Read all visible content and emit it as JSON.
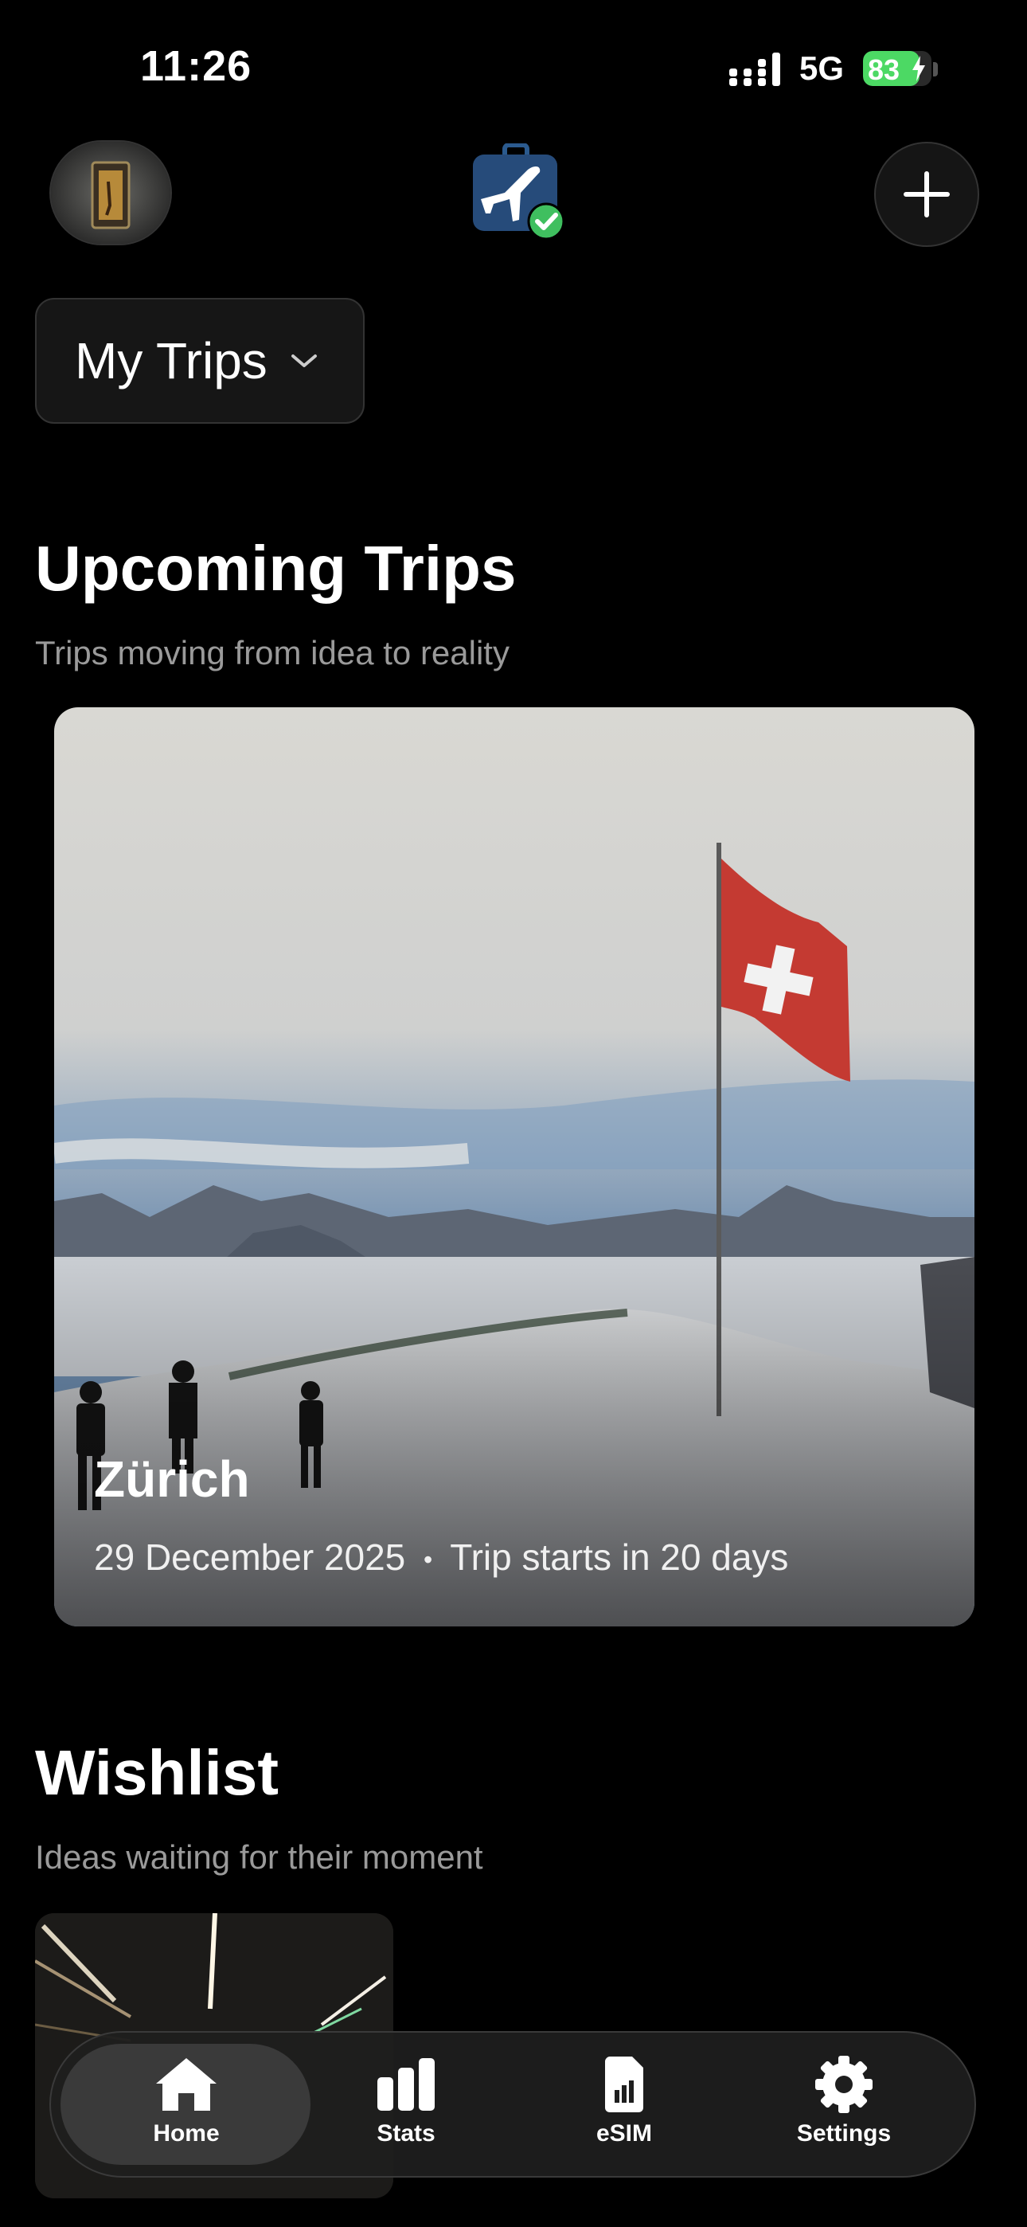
{
  "status_bar": {
    "time": "11:26",
    "network": "5G",
    "battery": "83",
    "battery_level": 0.83,
    "battery_color": "#4cd964"
  },
  "header": {
    "avatar_icon": "door-photo-avatar",
    "logo_icon": "suitcase-plane-check-icon",
    "add_icon": "plus-icon"
  },
  "trips_selector": {
    "label": "My Trips"
  },
  "upcoming": {
    "title": "Upcoming Trips",
    "subtitle": "Trips moving from idea to reality",
    "trip": {
      "city": "Zürich",
      "date": "29 December 2025",
      "separator": "•",
      "countdown": "Trip starts in 20 days"
    }
  },
  "wishlist": {
    "title": "Wishlist",
    "subtitle": "Ideas waiting for their moment"
  },
  "tabs": [
    {
      "label": "Home",
      "icon": "home-icon",
      "active": true
    },
    {
      "label": "Stats",
      "icon": "bar-chart-icon",
      "active": false
    },
    {
      "label": "eSIM",
      "icon": "sim-card-icon",
      "active": false
    },
    {
      "label": "Settings",
      "icon": "gear-icon",
      "active": false
    }
  ]
}
